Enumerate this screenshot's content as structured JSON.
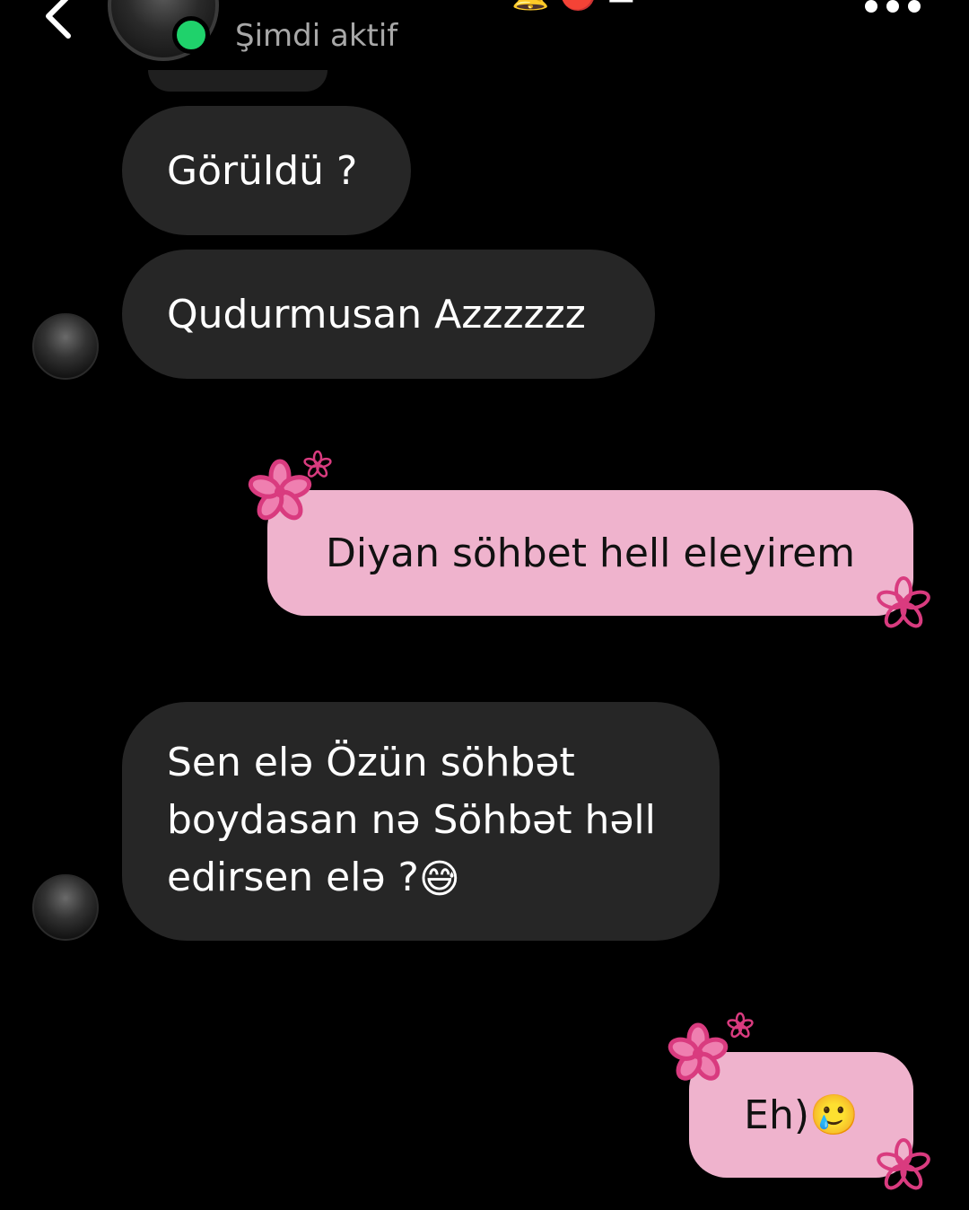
{
  "header": {
    "name": "▪▪▪▪▪▪▪▪▪▪▪▪▪",
    "status": "Şimdi aktif",
    "emojis": "🔔 🔴 ▬",
    "colors": {
      "online": "#1fd26b",
      "status_text": "#a8a8a8"
    }
  },
  "messages": [
    {
      "side": "incoming",
      "text": "Görüldü ?"
    },
    {
      "side": "incoming",
      "text": "Qudurmusan Azzzzzz"
    },
    {
      "side": "outgoing",
      "text": "Diyan söhbet hell eleyirem"
    },
    {
      "side": "incoming",
      "text": "Sen elə Özün söhbət boydasan nə Söhbət həll edirsen elə ?",
      "emoji": "😅"
    },
    {
      "side": "outgoing",
      "text": "Eh)",
      "emoji": "🥲"
    }
  ],
  "theme": {
    "background": "#000000",
    "incoming_bubble": "#262626",
    "outgoing_bubble": "#efb3cd",
    "flower_color": "#d93b7f"
  },
  "icons": {
    "back": "chevron-left-icon",
    "more": "more-horizontal-icon",
    "decoration": "flower-icon"
  }
}
